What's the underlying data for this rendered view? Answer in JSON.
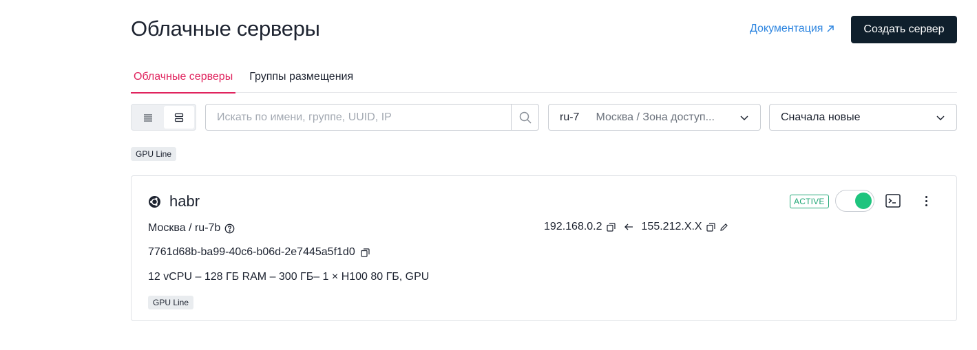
{
  "header": {
    "title": "Облачные серверы",
    "docs_label": "Документация",
    "create_label": "Создать сервер"
  },
  "tabs": [
    {
      "label": "Облачные серверы",
      "active": true
    },
    {
      "label": "Группы размещения",
      "active": false
    }
  ],
  "toolbar": {
    "search_placeholder": "Искать по имени, группе, UUID, IP",
    "region_code": "ru-7",
    "region_name": "Москва  /  Зона доступ...",
    "sort_label": "Сначала новые",
    "view_mode": "cards"
  },
  "filter_tag": "GPU Line",
  "server": {
    "name": "habr",
    "os_icon": "ubuntu-icon",
    "status": "ACTIVE",
    "power_on": true,
    "location": "Москва / ru-7b",
    "uuid": "7761d68b-ba99-40c6-b06d-2e7445a5f1d0",
    "specs": "12 vCPU – 128 ГБ RAM – 300 ГБ– 1 × H100  80 ГБ, GPU",
    "tag": "GPU Line",
    "private_ip": "192.168.0.2",
    "public_ip": "155.212.X.X"
  },
  "colors": {
    "accent": "#e0245e",
    "link": "#2f86e0",
    "primary_button": "#0f1f2c",
    "active_status": "#1fa775",
    "power_on": "#1ec47e"
  }
}
